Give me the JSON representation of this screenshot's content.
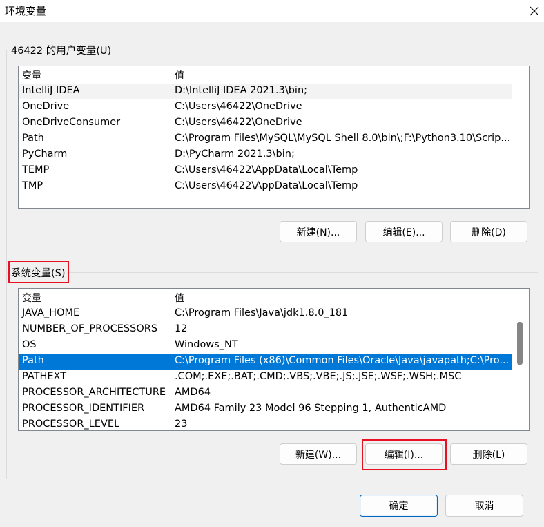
{
  "window": {
    "title": "环境变量",
    "close_icon": "close-icon"
  },
  "user_group": {
    "label": "46422 的用户变量(U)",
    "columns": [
      "变量",
      "值"
    ],
    "rows": [
      {
        "name": "IntelliJ IDEA",
        "value": "D:\\IntelliJ IDEA 2021.3\\bin;"
      },
      {
        "name": "OneDrive",
        "value": "C:\\Users\\46422\\OneDrive"
      },
      {
        "name": "OneDriveConsumer",
        "value": "C:\\Users\\46422\\OneDrive"
      },
      {
        "name": "Path",
        "value": "C:\\Program Files\\MySQL\\MySQL Shell 8.0\\bin\\;F:\\Python3.10\\Scrip..."
      },
      {
        "name": "PyCharm",
        "value": "D:\\PyCharm 2021.3\\bin;"
      },
      {
        "name": "TEMP",
        "value": "C:\\Users\\46422\\AppData\\Local\\Temp"
      },
      {
        "name": "TMP",
        "value": "C:\\Users\\46422\\AppData\\Local\\Temp"
      }
    ],
    "hovered_row": "IntelliJ IDEA",
    "buttons": {
      "new": "新建(N)...",
      "edit": "编辑(E)...",
      "delete": "删除(D)"
    }
  },
  "system_group": {
    "label": "系统变量(S)",
    "columns": [
      "变量",
      "值"
    ],
    "rows": [
      {
        "name": "JAVA_HOME",
        "value": "C:\\Program Files\\Java\\jdk1.8.0_181"
      },
      {
        "name": "NUMBER_OF_PROCESSORS",
        "value": "12"
      },
      {
        "name": "OS",
        "value": "Windows_NT"
      },
      {
        "name": "Path",
        "value": "C:\\Program Files (x86)\\Common Files\\Oracle\\Java\\javapath;C:\\Pro..."
      },
      {
        "name": "PATHEXT",
        "value": ".COM;.EXE;.BAT;.CMD;.VBS;.VBE;.JS;.JSE;.WSF;.WSH;.MSC"
      },
      {
        "name": "PROCESSOR_ARCHITECTURE",
        "value": "AMD64"
      },
      {
        "name": "PROCESSOR_IDENTIFIER",
        "value": "AMD64 Family 23 Model 96 Stepping 1, AuthenticAMD"
      },
      {
        "name": "PROCESSOR_LEVEL",
        "value": "23"
      }
    ],
    "selected_row": "Path",
    "buttons": {
      "new": "新建(W)...",
      "edit": "编辑(I)...",
      "delete": "删除(L)"
    }
  },
  "footer": {
    "ok": "确定",
    "cancel": "取消"
  },
  "colors": {
    "selection": "#0078d7",
    "highlight_box": "#e81123",
    "default_button_border": "#0067c0"
  }
}
